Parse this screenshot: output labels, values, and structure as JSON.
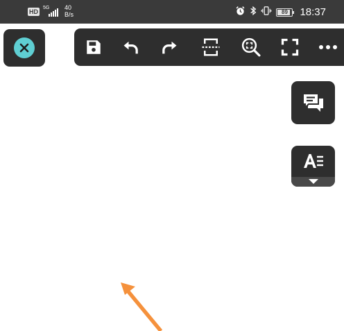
{
  "status_bar": {
    "hd": "HD",
    "network": "5G",
    "speed_value": "40",
    "speed_unit": "B/s",
    "battery": "89",
    "time": "18:37",
    "icons": [
      "alarm-icon",
      "bluetooth-icon",
      "vibrate-icon",
      "battery-icon"
    ]
  },
  "toolbar": {
    "buttons": [
      "save",
      "undo",
      "redo",
      "crop-page",
      "zoom-fit",
      "fullscreen",
      "more"
    ]
  },
  "side_buttons": [
    "comment",
    "text-format"
  ],
  "colors": {
    "panel": "#2e2e2e",
    "accent": "#5fcfd3",
    "status_bar": "#3a3a3a",
    "arrow": "#f5913c"
  }
}
